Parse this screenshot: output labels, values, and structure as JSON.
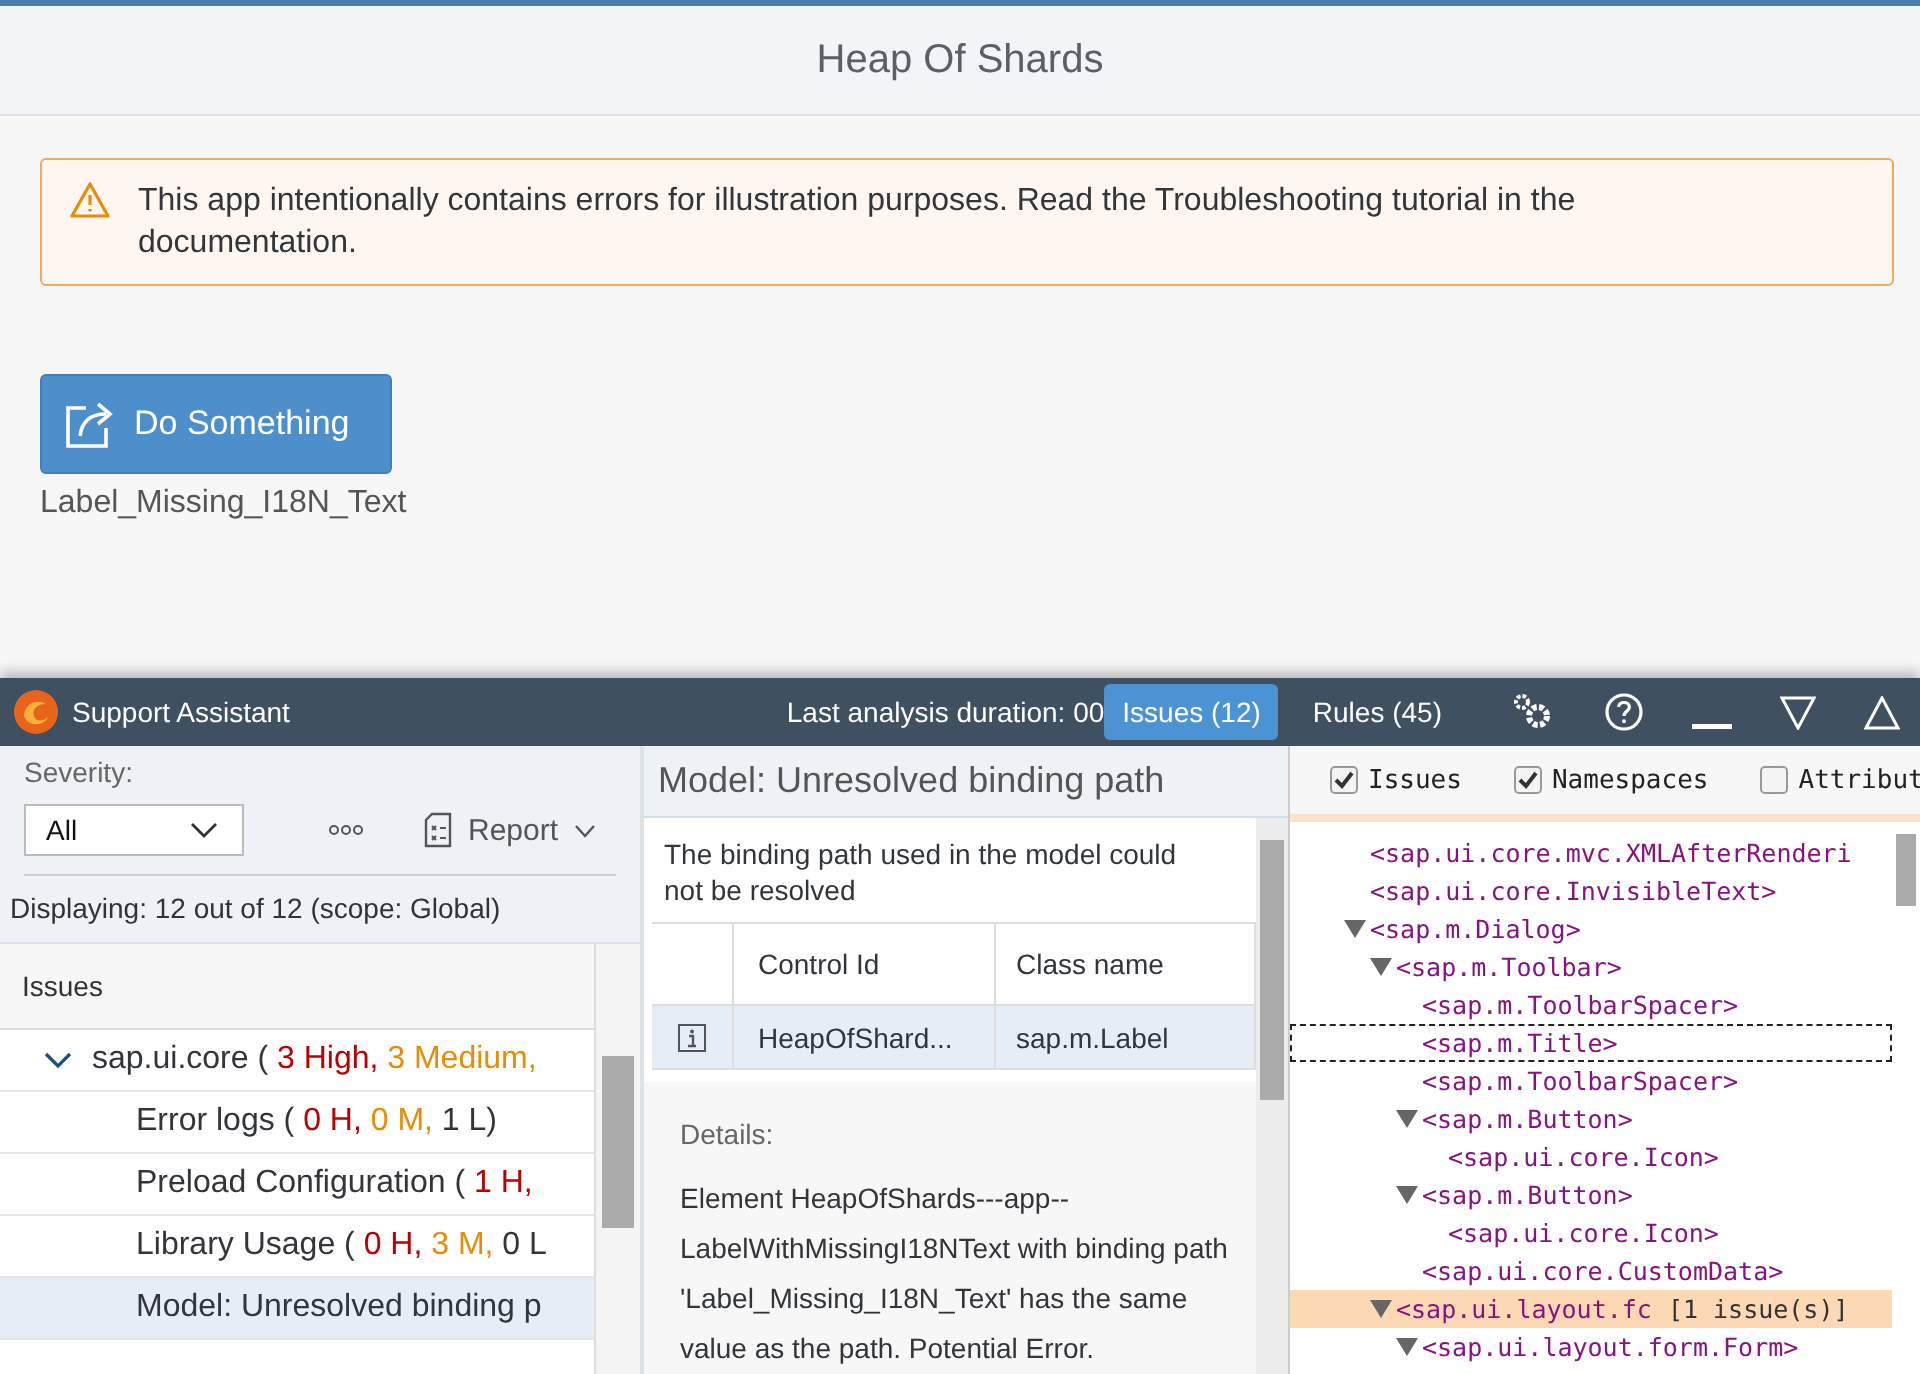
{
  "app": {
    "title": "Heap Of Shards",
    "warning": "This app intentionally contains errors for illustration purposes. Read the Troubleshooting tutorial in the documentation.",
    "button": "Do Something",
    "label": "Label_Missing_I18N_Text"
  },
  "assistant": {
    "title": "Support Assistant",
    "duration": "Last analysis duration: 00",
    "tabs": [
      {
        "label": "Issues (12)",
        "selected": true
      },
      {
        "label": "Rules (45)",
        "selected": false
      }
    ],
    "filter": {
      "label": "Severity:",
      "value": "All",
      "report": "Report",
      "displaying": "Displaying: 12 out of 12 (scope: Global)"
    },
    "issues_header": "Issues",
    "issues": [
      {
        "segments": [
          {
            "text": "sap.ui.core ( ",
            "kind": "plain"
          },
          {
            "text": "3 High,",
            "kind": "high"
          },
          {
            "text": " 3 Medium,",
            "kind": "medium"
          }
        ],
        "expanded": true,
        "selected": false,
        "children": [
          {
            "segments": [
              {
                "text": "Error logs ( ",
                "kind": "plain"
              },
              {
                "text": "0 H,",
                "kind": "high"
              },
              {
                "text": " 0 M,",
                "kind": "medium"
              },
              {
                "text": " 1 L)",
                "kind": "plain"
              }
            ],
            "selected": false
          },
          {
            "segments": [
              {
                "text": "Preload Configuration ( ",
                "kind": "plain"
              },
              {
                "text": "1 H,",
                "kind": "high"
              }
            ],
            "selected": false
          },
          {
            "segments": [
              {
                "text": "Library Usage ( ",
                "kind": "plain"
              },
              {
                "text": "0 H,",
                "kind": "high"
              },
              {
                "text": " 3 M,",
                "kind": "medium"
              },
              {
                "text": " 0 L",
                "kind": "plain"
              }
            ],
            "selected": false
          },
          {
            "segments": [
              {
                "text": "Model: Unresolved binding p",
                "kind": "plain"
              }
            ],
            "selected": true
          }
        ]
      }
    ],
    "detail": {
      "title": "Model: Unresolved binding path",
      "description": "The binding path used in the model could not be resolved",
      "columns": [
        "Control Id",
        "Class name"
      ],
      "rows": [
        {
          "cells": [
            "HeapOfShard...",
            "sap.m.Label"
          ],
          "selected": true
        }
      ],
      "details_label": "Details:",
      "details_text": "Element HeapOfShards---app--LabelWithMissingI18NText with binding path 'Label_Missing_I18N_Text' has the same value as the path. Potential Error."
    },
    "tree_options": [
      {
        "label": "Issues",
        "checked": true
      },
      {
        "label": "Namespaces",
        "checked": true
      },
      {
        "label": "Attribut",
        "checked": false
      }
    ],
    "tree": [
      {
        "label": "<sap.ui.core.mvc.XMLAfterRenderi",
        "selected": false
      },
      {
        "label": "<sap.ui.core.InvisibleText>",
        "selected": false
      },
      {
        "label": "<sap.m.Dialog>",
        "selected": false,
        "expanded": true,
        "children": [
          {
            "label": "<sap.m.Toolbar>",
            "selected": false,
            "expanded": true,
            "children": [
              {
                "label": "<sap.m.ToolbarSpacer>",
                "selected": false
              },
              {
                "label": "<sap.m.Title>",
                "selected": true
              },
              {
                "label": "<sap.m.ToolbarSpacer>",
                "selected": false
              },
              {
                "label": "<sap.m.Button>",
                "selected": false,
                "expanded": true,
                "children": [
                  {
                    "label": "<sap.ui.core.Icon>",
                    "selected": false
                  }
                ]
              },
              {
                "label": "<sap.m.Button>",
                "selected": false,
                "expanded": true,
                "children": [
                  {
                    "label": "<sap.ui.core.Icon>",
                    "selected": false
                  }
                ]
              },
              {
                "label": "<sap.ui.core.CustomData>",
                "selected": false
              }
            ]
          },
          {
            "label": "<sap.ui.layout.fc",
            "issue": "[1 issue(s)]",
            "selected": false,
            "expanded": true,
            "children": [
              {
                "label": "<sap.ui.layout.form.Form>",
                "selected": false,
                "expanded": true
              }
            ]
          }
        ]
      }
    ]
  }
}
